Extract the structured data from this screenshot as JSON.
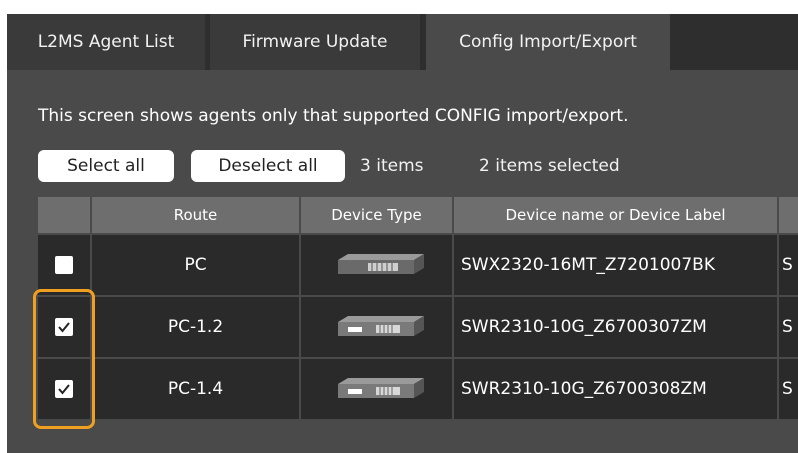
{
  "tabs": [
    {
      "label": "L2MS Agent List",
      "active": false
    },
    {
      "label": "Firmware Update",
      "active": false
    },
    {
      "label": "Config Import/Export",
      "active": true
    }
  ],
  "notice": "This screen shows agents only that supported CONFIG import/export.",
  "toolbar": {
    "select_all": "Select all",
    "deselect_all": "Deselect all",
    "item_count": "3 items",
    "selected_count": "2 items selected"
  },
  "table": {
    "headers": [
      "",
      "Route",
      "Device Type",
      "Device name or Device Label",
      ""
    ],
    "rows": [
      {
        "checked": false,
        "route": "PC",
        "device_icon": "network-switch-icon",
        "device_name": "SWX2320-16MT_Z7201007BK",
        "extra": "S"
      },
      {
        "checked": true,
        "route": "PC-1.2",
        "device_icon": "network-switch-icon",
        "device_name": "SWR2310-10G_Z6700307ZM",
        "extra": "S"
      },
      {
        "checked": true,
        "route": "PC-1.4",
        "device_icon": "network-switch-icon",
        "device_name": "SWR2310-10G_Z6700308ZM",
        "extra": "S"
      }
    ]
  },
  "colors": {
    "background": "#4a4a4a",
    "tabbar": "#2e2e2e",
    "header": "#6e6e6e",
    "row": "#2a2a2a",
    "highlight": "#f0a020"
  }
}
